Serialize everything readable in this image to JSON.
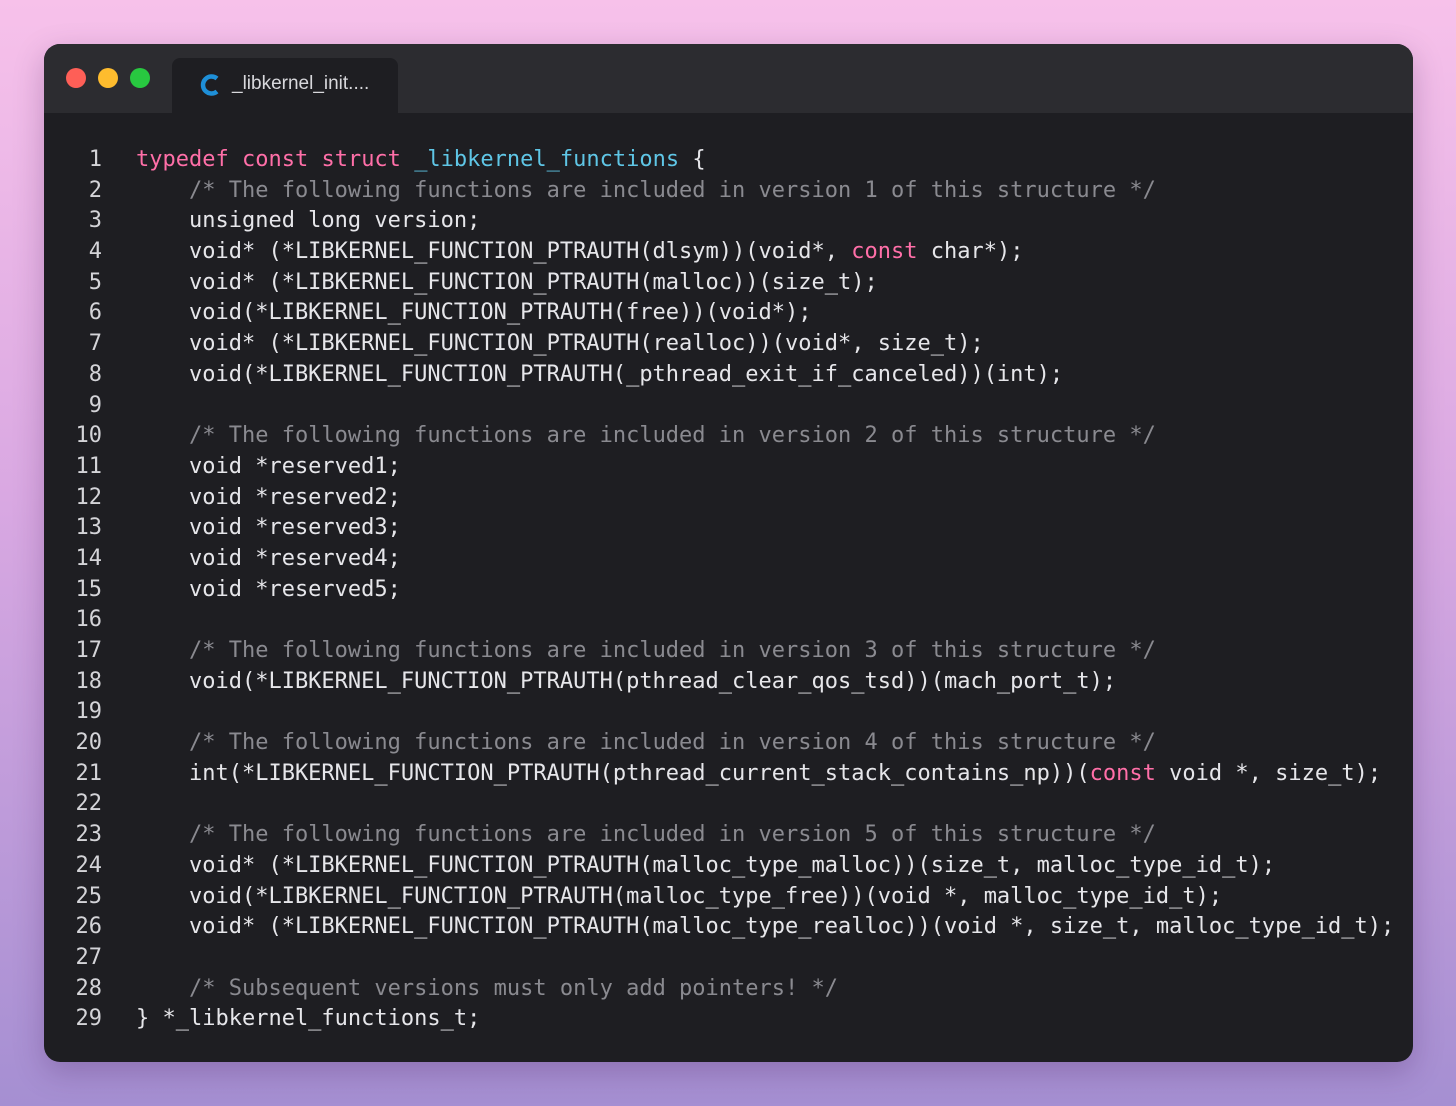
{
  "window": {
    "traffic_lights": [
      "close",
      "minimize",
      "zoom"
    ],
    "colors": {
      "background": "#1e1e22",
      "titlebar": "#2c2c30",
      "keyword": "#ff6fa8",
      "function_name": "#5fc6e6",
      "comment": "#8a8a90",
      "text": "#e6e6ea"
    }
  },
  "tab": {
    "icon": "c-language-icon",
    "label": "_libkernel_init...."
  },
  "code": [
    {
      "n": "1",
      "tokens": [
        [
          "kw",
          "typedef"
        ],
        [
          "p",
          " "
        ],
        [
          "kw",
          "const"
        ],
        [
          "p",
          " "
        ],
        [
          "kw",
          "struct"
        ],
        [
          "p",
          " "
        ],
        [
          "fn",
          "_libkernel_functions"
        ],
        [
          "p",
          " {"
        ]
      ]
    },
    {
      "n": "2",
      "tokens": [
        [
          "p",
          "    "
        ],
        [
          "cm",
          "/* The following functions are included in version 1 of this structure */"
        ]
      ]
    },
    {
      "n": "3",
      "tokens": [
        [
          "p",
          "    unsigned long version;"
        ]
      ]
    },
    {
      "n": "4",
      "tokens": [
        [
          "p",
          "    void* (*LIBKERNEL_FUNCTION_PTRAUTH(dlsym))(void*, "
        ],
        [
          "kw",
          "const"
        ],
        [
          "p",
          " char*);"
        ]
      ]
    },
    {
      "n": "5",
      "tokens": [
        [
          "p",
          "    void* (*LIBKERNEL_FUNCTION_PTRAUTH(malloc))(size_t);"
        ]
      ]
    },
    {
      "n": "6",
      "tokens": [
        [
          "p",
          "    void(*LIBKERNEL_FUNCTION_PTRAUTH(free))(void*);"
        ]
      ]
    },
    {
      "n": "7",
      "tokens": [
        [
          "p",
          "    void* (*LIBKERNEL_FUNCTION_PTRAUTH(realloc))(void*, size_t);"
        ]
      ]
    },
    {
      "n": "8",
      "tokens": [
        [
          "p",
          "    void(*LIBKERNEL_FUNCTION_PTRAUTH(_pthread_exit_if_canceled))(int);"
        ]
      ]
    },
    {
      "n": "9",
      "tokens": []
    },
    {
      "n": "10",
      "tokens": [
        [
          "p",
          "    "
        ],
        [
          "cm",
          "/* The following functions are included in version 2 of this structure */"
        ]
      ]
    },
    {
      "n": "11",
      "tokens": [
        [
          "p",
          "    void *reserved1;"
        ]
      ]
    },
    {
      "n": "12",
      "tokens": [
        [
          "p",
          "    void *reserved2;"
        ]
      ]
    },
    {
      "n": "13",
      "tokens": [
        [
          "p",
          "    void *reserved3;"
        ]
      ]
    },
    {
      "n": "14",
      "tokens": [
        [
          "p",
          "    void *reserved4;"
        ]
      ]
    },
    {
      "n": "15",
      "tokens": [
        [
          "p",
          "    void *reserved5;"
        ]
      ]
    },
    {
      "n": "16",
      "tokens": []
    },
    {
      "n": "17",
      "tokens": [
        [
          "p",
          "    "
        ],
        [
          "cm",
          "/* The following functions are included in version 3 of this structure */"
        ]
      ]
    },
    {
      "n": "18",
      "tokens": [
        [
          "p",
          "    void(*LIBKERNEL_FUNCTION_PTRAUTH(pthread_clear_qos_tsd))(mach_port_t);"
        ]
      ]
    },
    {
      "n": "19",
      "tokens": []
    },
    {
      "n": "20",
      "tokens": [
        [
          "p",
          "    "
        ],
        [
          "cm",
          "/* The following functions are included in version 4 of this structure */"
        ]
      ]
    },
    {
      "n": "21",
      "tokens": [
        [
          "p",
          "    int(*LIBKERNEL_FUNCTION_PTRAUTH(pthread_current_stack_contains_np))("
        ],
        [
          "kw",
          "const"
        ],
        [
          "p",
          " void *, size_t);"
        ]
      ]
    },
    {
      "n": "22",
      "tokens": []
    },
    {
      "n": "23",
      "tokens": [
        [
          "p",
          "    "
        ],
        [
          "cm",
          "/* The following functions are included in version 5 of this structure */"
        ]
      ]
    },
    {
      "n": "24",
      "tokens": [
        [
          "p",
          "    void* (*LIBKERNEL_FUNCTION_PTRAUTH(malloc_type_malloc))(size_t, malloc_type_id_t);"
        ]
      ]
    },
    {
      "n": "25",
      "tokens": [
        [
          "p",
          "    void(*LIBKERNEL_FUNCTION_PTRAUTH(malloc_type_free))(void *, malloc_type_id_t);"
        ]
      ]
    },
    {
      "n": "26",
      "tokens": [
        [
          "p",
          "    void* (*LIBKERNEL_FUNCTION_PTRAUTH(malloc_type_realloc))(void *, size_t, malloc_type_id_t);"
        ]
      ]
    },
    {
      "n": "27",
      "tokens": []
    },
    {
      "n": "28",
      "tokens": [
        [
          "p",
          "    "
        ],
        [
          "cm",
          "/* Subsequent versions must only add pointers! */"
        ]
      ]
    },
    {
      "n": "29",
      "tokens": [
        [
          "p",
          "} *_libkernel_functions_t;"
        ]
      ]
    }
  ]
}
